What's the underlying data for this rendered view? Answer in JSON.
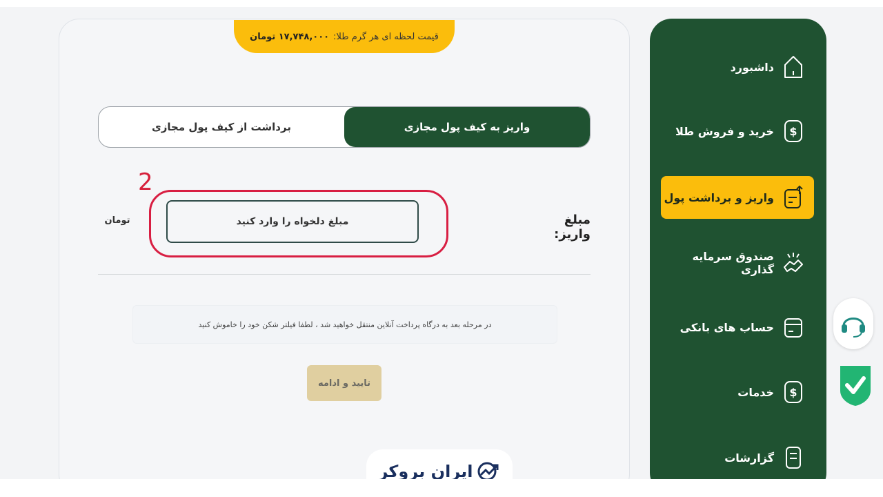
{
  "header": {
    "gold_price_label": "قیمت لحظه ای هر گرم طلا:",
    "gold_price_value": "۱۷,۷۴۸,۰۰۰ تومان"
  },
  "tabs": {
    "deposit": "واریز به کیف پول مجازی",
    "withdraw": "برداشت از کیف پول مجازی"
  },
  "form": {
    "step_number": "2",
    "amount_label": "مبلغ واریز:",
    "amount_placeholder": "مبلغ دلخواه را وارد کنید",
    "currency": "تومان",
    "notice": "در مرحله بعد به درگاه پرداخت آنلاین منتقل خواهید شد ، لطفا فیلتر شکن خود را خاموش کنید",
    "confirm_button": "تایید و ادامه"
  },
  "brand": {
    "name": "ایران بروکر"
  },
  "sidebar": {
    "items": [
      {
        "label": "داشبورد",
        "icon": "home-icon",
        "active": false
      },
      {
        "label": "خرید و فروش طلا",
        "icon": "dollar-icon",
        "active": false
      },
      {
        "label": "واریز و برداشت پول",
        "icon": "wallet-transfer-icon",
        "active": true
      },
      {
        "label": "صندوق سرمایه گذاری",
        "icon": "handshake-icon",
        "active": false
      },
      {
        "label": "حساب های بانکی",
        "icon": "card-icon",
        "active": false
      },
      {
        "label": "خدمات",
        "icon": "dollar-icon",
        "active": false
      },
      {
        "label": "گزارشات",
        "icon": "report-icon",
        "active": false
      }
    ]
  },
  "floating": {
    "support_icon": "headset-icon",
    "trust_icon": "check-badge-icon"
  },
  "colors": {
    "primary_green": "#1f5231",
    "accent_yellow": "#fbbd0c",
    "highlight_red": "#d81e42",
    "button_disabled": "#e0cfa0"
  }
}
